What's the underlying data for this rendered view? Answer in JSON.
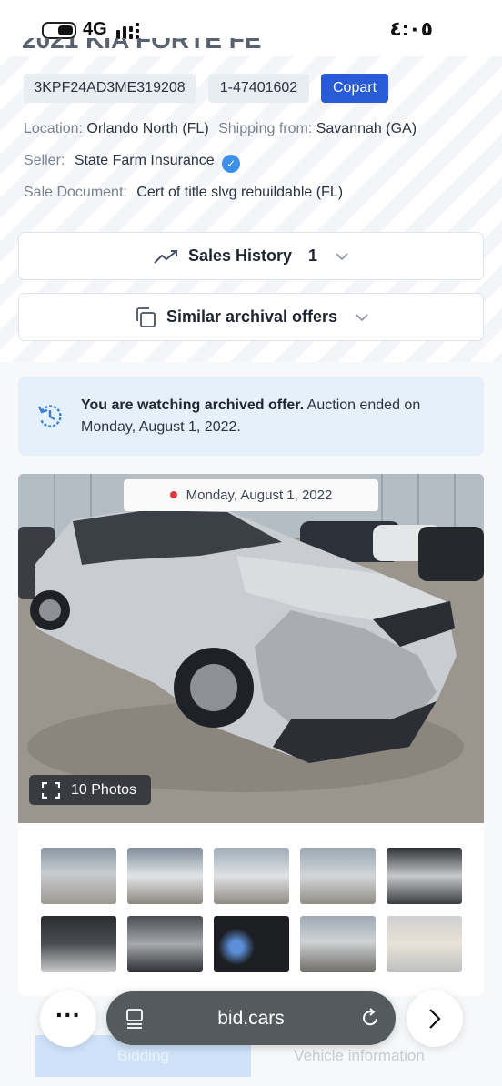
{
  "status_bar": {
    "network": "4G",
    "time": "٤:٠٥",
    "icons": [
      "battery-icon",
      "signal-icon"
    ]
  },
  "listing": {
    "title": "2021 KIA FORTE FE",
    "vin": "3KPF24AD3ME319208",
    "lot": "1-47401602",
    "auction": "Copart",
    "location_label": "Location:",
    "location": "Orlando North (FL)",
    "shipping_label": "Shipping from:",
    "shipping": "Savannah (GA)",
    "seller_label": "Seller:",
    "seller": "State Farm Insurance",
    "doc_label": "Sale Document:",
    "doc": "Cert of title slvg rebuildable (FL)"
  },
  "sections": {
    "sales_history": "Sales History",
    "sales_history_count": "1",
    "similar": "Similar archival offers"
  },
  "notice": {
    "bold": "You are watching archived offer.",
    "rest": " Auction ended on Monday, August 1, 2022."
  },
  "gallery": {
    "date": "Monday, August 1, 2022",
    "photos_label": "10 Photos",
    "thumbs": [
      "front-left damage view",
      "front view",
      "rear-left view",
      "rear view",
      "interior front seats",
      "interior rear seats",
      "engine bay",
      "instrument cluster",
      "front damage close-up",
      "window sticker label"
    ]
  },
  "browser": {
    "url": "bid.cars"
  },
  "bottom_tabs": {
    "bidding": "Bidding",
    "vehicle_info": "Vehicle information"
  },
  "colors": {
    "accent": "#2a5bd7",
    "notice_bg": "#e6f0fb",
    "verified": "#3b8fe8"
  }
}
